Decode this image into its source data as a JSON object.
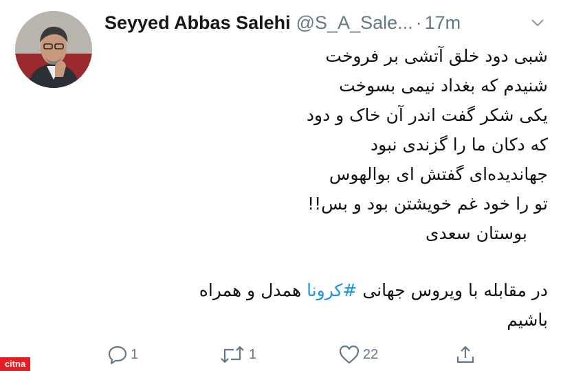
{
  "user": {
    "display_name": "Seyyed Abbas Salehi",
    "handle": "@S_A_Sale...",
    "separator": "·",
    "time": "17m"
  },
  "tweet": {
    "lines": [
      "شبی دود خلق آتشی بر فروخت",
      "شنیدم که بغداد نیمی بسوخت",
      "یکی شکر گفت اندر آن خاک و دود",
      "که دکان ما را گزندی نبود",
      "جهاندیده‌ای گفتش ای بوالهوس",
      "تو را خود غم خویشتن بود و بس!!",
      "بوستان سعدی"
    ],
    "para2_before": "در مقابله با  ویروس جهانی ",
    "hashtag": "#کرونا",
    "para2_after": " همدل و همراه",
    "para2_line2": "باشیم"
  },
  "actions": {
    "reply_count": "1",
    "retweet_count": "1",
    "like_count": "22"
  },
  "icons": [
    "chevron-down-icon",
    "reply-icon",
    "retweet-icon",
    "heart-icon",
    "share-icon"
  ],
  "watermark": "citna"
}
